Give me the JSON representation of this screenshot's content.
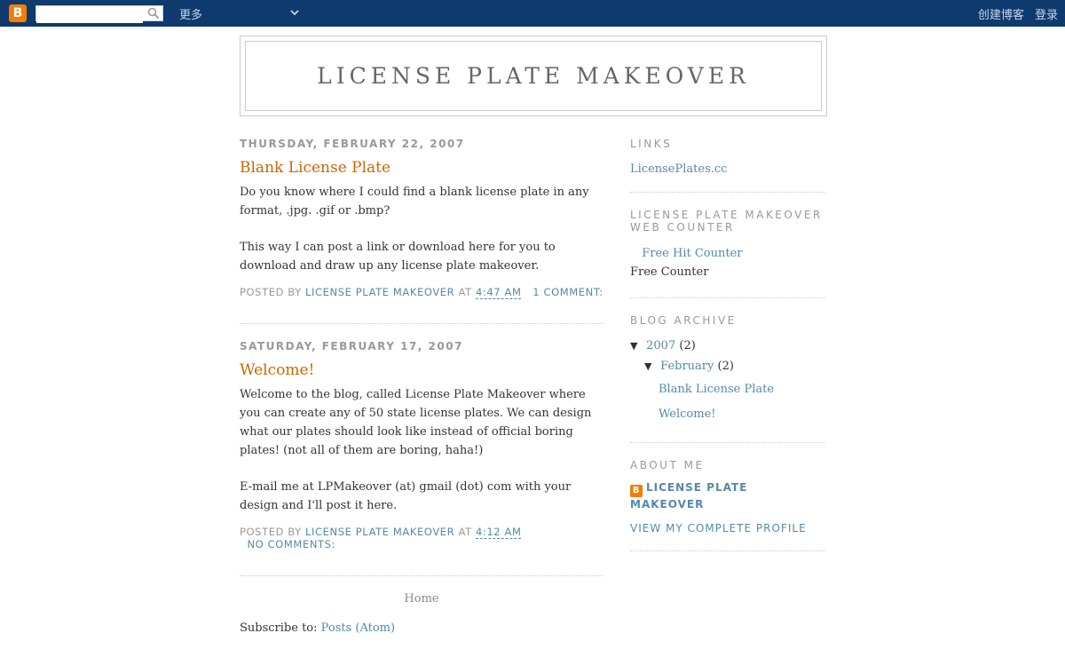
{
  "navbar": {
    "logo_letter": "B",
    "search_placeholder": "",
    "more_label": "更多",
    "create_blog": "创建博客",
    "login": "登录"
  },
  "blog": {
    "title": "License Plate Makeover"
  },
  "posts": [
    {
      "date": "Thursday, February 22, 2007",
      "title": "Blank License Plate",
      "paragraphs": [
        "Do you know where I could find a blank license plate in any format, .jpg. .gif or .bmp?",
        "This way I can post a link or download here for you to download and draw up any license plate makeover."
      ],
      "posted_by_label": "Posted by",
      "author": "License Plate Makeover",
      "at_label": "at",
      "time": "4:47 AM",
      "comments": "1 comment:"
    },
    {
      "date": "Saturday, February 17, 2007",
      "title": "Welcome!",
      "paragraphs": [
        "Welcome to the blog, called License Plate Makeover where you can create any of 50 state license plates. We can design what our plates should look like instead of official boring plates! (not all of them are boring, haha!)",
        "E-mail me at LPMakeover (at) gmail (dot) com with your design and I'll post it here."
      ],
      "posted_by_label": "Posted by",
      "author": "License Plate Makeover",
      "at_label": "at",
      "time": "4:12 AM",
      "comments": "No comments:"
    }
  ],
  "footer": {
    "home": "Home",
    "subscribe_label": "Subscribe to:",
    "subscribe_link": "Posts (Atom)"
  },
  "sidebar": {
    "links": {
      "title": "Links",
      "item": "LicensePlates.cc"
    },
    "counter": {
      "title": "License Plate Makeover Web Counter",
      "image_alt": "Free Hit Counter",
      "text": "Free Counter"
    },
    "archive": {
      "title": "Blog Archive",
      "year": "2007",
      "year_count": "(2)",
      "month": "February",
      "month_count": "(2)",
      "posts": [
        "Blank License Plate",
        "Welcome!"
      ]
    },
    "about": {
      "title": "About Me",
      "name": "License Plate Makeover",
      "view_profile": "View my complete profile"
    }
  },
  "colors": {
    "navbar": "#0f3a6e",
    "post_title": "#cc6600",
    "link": "#5588aa",
    "blogger_orange": "#f57d00"
  }
}
